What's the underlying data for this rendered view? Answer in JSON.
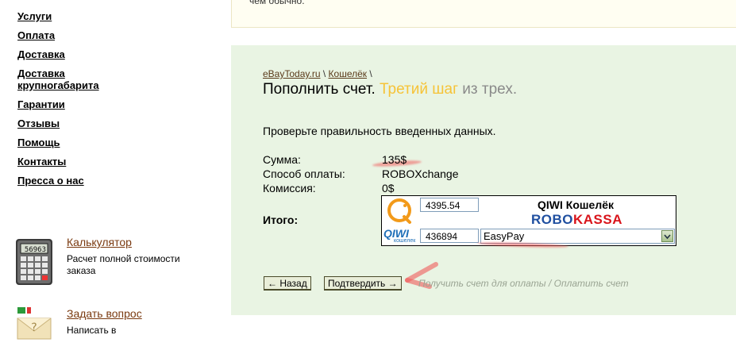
{
  "nav": {
    "items": [
      "Услуги",
      "Оплата",
      "Доставка",
      "Доставка крупногабарита",
      "Гарантии",
      "Отзывы",
      "Помощь",
      "Контакты",
      "Пресса о нас"
    ]
  },
  "widgets": {
    "calculator": {
      "title": "Калькулятор",
      "desc": "Расчет полной стоимости заказа",
      "display": "56963"
    },
    "question": {
      "title": "Задать вопрос",
      "desc": "Написать в"
    }
  },
  "top_notice": {
    "text": "чем обычно."
  },
  "breadcrumb": {
    "home": "eBayToday.ru",
    "sep1": "\\",
    "wallet": "Кошелёк",
    "sep2": "\\"
  },
  "heading": {
    "main": "Пополнить счет.",
    "step": "Третий шаг",
    "rest": "из трех."
  },
  "instruction": "Проверьте правильность введенных данных.",
  "summary": {
    "amount_label": "Сумма:",
    "amount_value": "135$",
    "method_label": "Способ оплаты:",
    "method_value": "ROBOXchange",
    "fee_label": "Комиссия:",
    "fee_value": "0$",
    "total_label": "Итого:"
  },
  "payment": {
    "amount_field": "4395.54",
    "code_field": "436894",
    "qiwi_title": "QIWI Кошелёк",
    "robokassa_robo": "ROBO",
    "robokassa_kassa": "KASSA",
    "qiwi_logo_text": "QIWI",
    "qiwi_logo_sub": "кошелек",
    "method_select": "EasyPay"
  },
  "buttons": {
    "back": "← Назад",
    "confirm": "Подтвердить →"
  },
  "hint": "Получить счет для оплаты / Оплатить счет",
  "colors": {
    "panel_bg": "#e9f4e3",
    "step_color": "#f6c338",
    "robo_red": "#d9141b",
    "robo_blue": "#1f4fa0"
  }
}
